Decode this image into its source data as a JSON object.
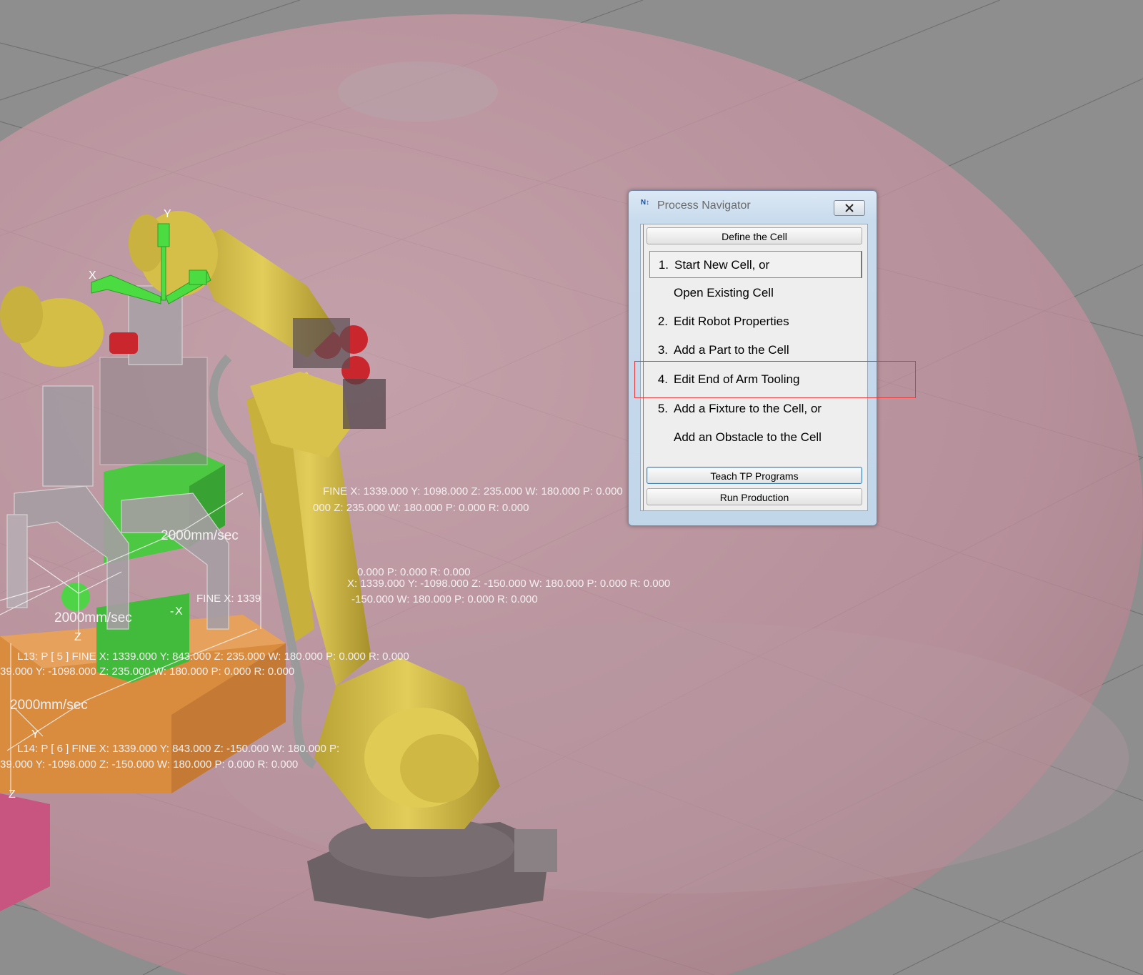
{
  "viewport": {
    "labels": [
      {
        "id": "a",
        "text": "L13: P [ 5 ]  FINE  X: 1339.000 Y: 843.000 Z: 235.000 W: 180.000 P: 0.000 R: 0.000"
      },
      {
        "id": "b",
        "text": "39.000 Y: -1098.000 Z: 235.000 W: 180.000 P: 0.000 R: 0.000"
      },
      {
        "id": "c",
        "text": "L14: P [ 6 ]  FINE  X: 1339.000 Y: 843.000 Z: -150.000 W: 180.000 P:"
      },
      {
        "id": "d",
        "text": "39.000 Y: -1098.000 Z: -150.000 W: 180.000 P: 0.000 R: 0.000"
      },
      {
        "id": "e",
        "text": "X: 1339.000 Y: -1098.000 Z: -150.000 W: 180.000 P: 0.000 R: 0.000"
      },
      {
        "id": "f",
        "text": "-150.000 W: 180.000 P: 0.000 R: 0.000"
      },
      {
        "id": "g",
        "text": "000 Z: 235.000 W: 180.000 P: 0.000 R: 0.000"
      },
      {
        "id": "h",
        "text": "FINE X: 1339.000 Y: 1098.000 Z: 235.000 W: 180.000 P: 0.000"
      },
      {
        "id": "i",
        "text": "2000mm/sec"
      },
      {
        "id": "j",
        "text": "2000mm/sec"
      },
      {
        "id": "k",
        "text": "2000mm/sec"
      },
      {
        "id": "l",
        "text": "FINE X: 1339"
      },
      {
        "id": "m",
        "text": "0.000 P: 0.000 R: 0.000"
      }
    ],
    "axis_labels": {
      "x": "X",
      "y": "Y",
      "z": "Z"
    }
  },
  "process_navigator": {
    "title": "Process Navigator",
    "icon_glyph": "N↕",
    "define_cell_label": "Define the Cell",
    "steps": [
      {
        "num": "1.",
        "label": "Start New Cell, or"
      },
      {
        "num": "",
        "label": "Open Existing Cell"
      },
      {
        "num": "2.",
        "label": "Edit Robot Properties"
      },
      {
        "num": "3.",
        "label": "Add a Part to the Cell"
      },
      {
        "num": "4.",
        "label": "Edit End of Arm Tooling"
      },
      {
        "num": "5.",
        "label": "Add a Fixture to the Cell, or"
      },
      {
        "num": "",
        "label": "Add an Obstacle to the Cell"
      }
    ],
    "teach_label": "Teach TP Programs",
    "run_label": "Run Production"
  },
  "colors": {
    "background": "#8e8e8e",
    "sphere": "#c79aa6",
    "robot_yellow": "#d8c24a",
    "motor_red": "#c9262d",
    "part_green": "#44c440",
    "fixture_orange": "#d98b3e",
    "obstacle_pink": "#c8557f",
    "highlight_red": "#e33b3b"
  }
}
